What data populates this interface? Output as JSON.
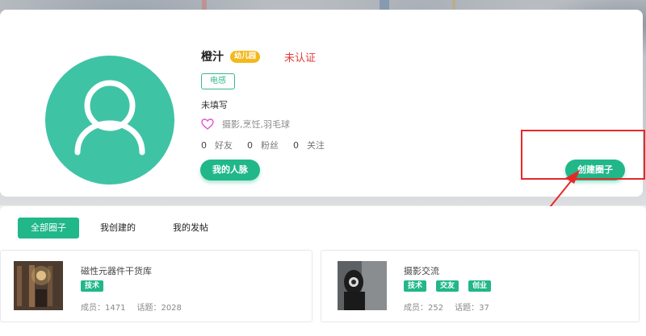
{
  "profile": {
    "username": "橙汁",
    "level_badge": "幼儿园",
    "certification_status": "未认证",
    "tag": "电感",
    "bio": "未填写",
    "interests": "摄影,烹饪,羽毛球",
    "stats": [
      {
        "count": "0",
        "label": "好友"
      },
      {
        "count": "0",
        "label": "粉丝"
      },
      {
        "count": "0",
        "label": "关注"
      }
    ],
    "network_button": "我的人脉",
    "create_circle_button": "创建圈子"
  },
  "tabs": [
    {
      "label": "全部圈子",
      "active": true
    },
    {
      "label": "我创建的",
      "active": false
    },
    {
      "label": "我的发帖",
      "active": false
    }
  ],
  "circles": [
    {
      "title": "磁性元器件干货库",
      "tags": [
        "技术"
      ],
      "members_label": "成员：",
      "members": "1471",
      "topics_label": "话题：",
      "topics": "2028"
    },
    {
      "title": "摄影交流",
      "tags": [
        "技术",
        "交友",
        "创业"
      ],
      "members_label": "成员：",
      "members": "252",
      "topics_label": "话题：",
      "topics": "37"
    }
  ],
  "colors": {
    "accent": "#21b788",
    "avatar_bg": "#3fc3a5",
    "badge": "#f3b81e",
    "warning": "#e23a3a",
    "highlight": "#e82828"
  }
}
